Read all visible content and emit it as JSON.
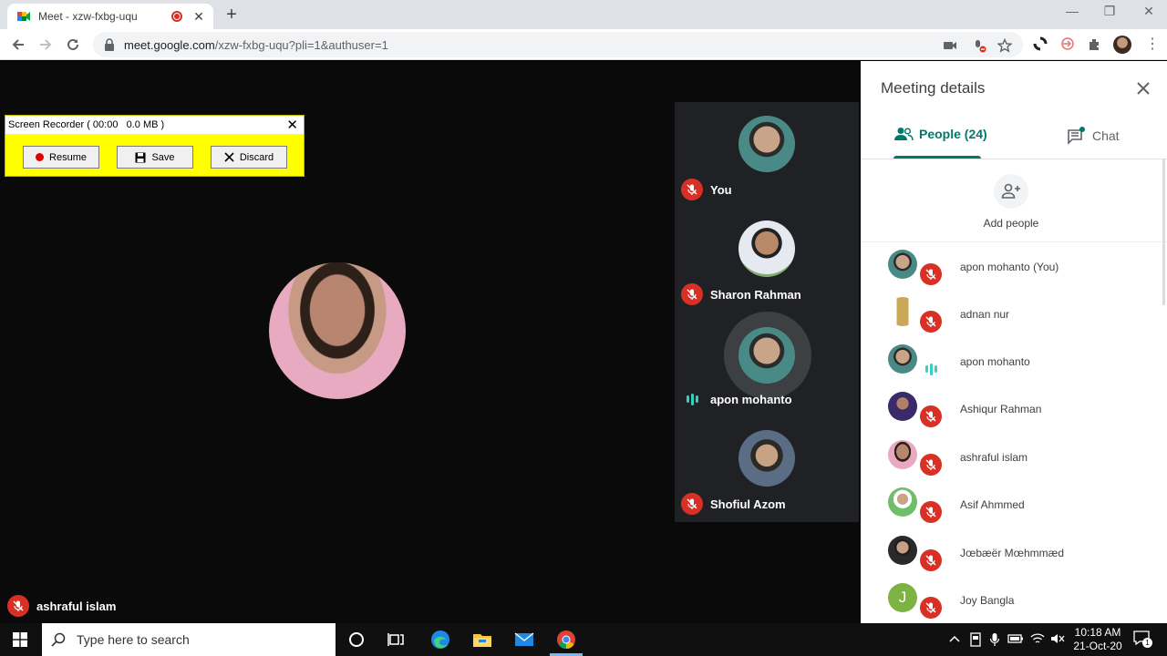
{
  "browser": {
    "tab_title": "Meet - xzw-fxbg-uqu",
    "tab_close": "✕",
    "new_tab": "+",
    "url_host": "meet.google.com",
    "url_path": "/xzw-fxbg-uqu?pli=1&authuser=1",
    "window_minimize": "—",
    "window_restore": "❐",
    "window_close": "✕",
    "menu": "⋮"
  },
  "recorder": {
    "title": "Screen Recorder ( 00:00   0.0 MB )",
    "close": "✕",
    "resume_label": "Resume",
    "save_label": "Save",
    "discard_label": "Discard"
  },
  "stage": {
    "main_name": "ashraful islam",
    "tiles": [
      {
        "name": "You",
        "status": "muted"
      },
      {
        "name": "Sharon Rahman",
        "status": "muted"
      },
      {
        "name": "apon mohanto",
        "status": "speaking"
      },
      {
        "name": "Shofiul Azom",
        "status": "muted"
      }
    ]
  },
  "panel": {
    "title": "Meeting details",
    "tab_people": "People (24)",
    "tab_chat": "Chat",
    "add_people": "Add people",
    "people": [
      {
        "name": "apon mohanto (You)",
        "status": "muted"
      },
      {
        "name": "adnan nur",
        "status": "muted"
      },
      {
        "name": "apon mohanto",
        "status": "speaking"
      },
      {
        "name": "Ashiqur Rahman",
        "status": "muted"
      },
      {
        "name": "ashraful islam",
        "status": "muted"
      },
      {
        "name": "Asif Ahmmed",
        "status": "muted"
      },
      {
        "name": "Jœbæër Mœhmmæd",
        "status": "muted"
      },
      {
        "name": "Joy Bangla",
        "status": "muted",
        "initial": "J"
      }
    ]
  },
  "taskbar": {
    "search_placeholder": "Type here to search",
    "time": "10:18 AM",
    "date": "21-Oct-20",
    "notification_count": "1"
  },
  "colors": {
    "accent": "#00796b",
    "mute_red": "#d93025",
    "speaking": "#34d1bf",
    "recorder_bg": "#ffff00"
  }
}
